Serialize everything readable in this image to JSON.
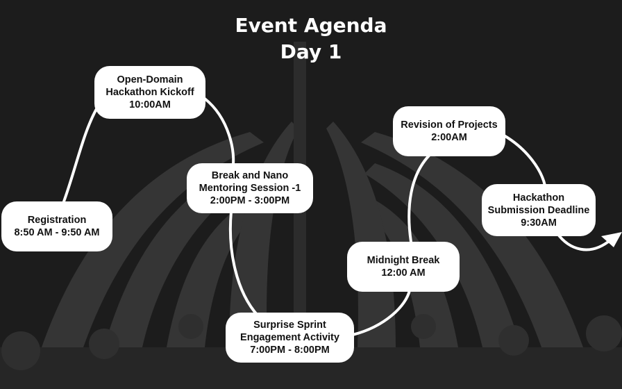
{
  "title": {
    "line1": "Event Agenda",
    "line2": "Day 1"
  },
  "colors": {
    "background": "#1c1c1c",
    "card": "#ffffff",
    "text": "#111111",
    "line": "#ffffff"
  },
  "agenda": [
    {
      "title_lines": [
        "Registration"
      ],
      "time": "8:50 AM - 9:50 AM"
    },
    {
      "title_lines": [
        "Open-Domain",
        "Hackathon Kickoff"
      ],
      "time": "10:00AM"
    },
    {
      "title_lines": [
        "Break and Nano",
        "Mentoring Session -1"
      ],
      "time": "2:00PM - 3:00PM"
    },
    {
      "title_lines": [
        "Surprise Sprint",
        "Engagement Activity"
      ],
      "time": "7:00PM - 8:00PM"
    },
    {
      "title_lines": [
        "Midnight Break"
      ],
      "time": "12:00 AM"
    },
    {
      "title_lines": [
        "Revision of Projects"
      ],
      "time": "2:00AM"
    },
    {
      "title_lines": [
        "Hackathon",
        "Submission Deadline"
      ],
      "time": "9:30AM"
    }
  ],
  "end_marker": "arrow-icon"
}
